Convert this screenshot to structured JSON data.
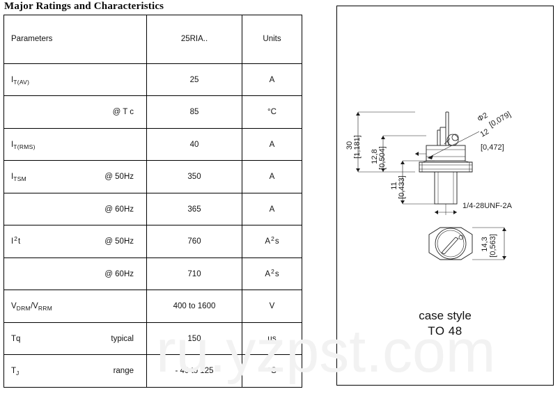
{
  "document": {
    "title": "Major Ratings and Characteristics"
  },
  "table": {
    "headers": {
      "parameters": "Parameters",
      "type": "25RIA..",
      "units": "Units"
    },
    "rows": [
      {
        "id": "it-av",
        "label_main": "I",
        "label_sub": "T(AV)",
        "condition": "",
        "value": "25",
        "units": "A"
      },
      {
        "id": "it-av-tc",
        "label_main": "",
        "label_sub": "",
        "condition": "@ T c",
        "value": "85",
        "units": "°C"
      },
      {
        "id": "it-rms",
        "label_main": "I",
        "label_sub": "T(RMS)",
        "condition": "",
        "value": "40",
        "units": "A"
      },
      {
        "id": "itsm-50",
        "label_main": "I",
        "label_sub": "TSM",
        "condition": "@ 50Hz",
        "value": "350",
        "units": "A"
      },
      {
        "id": "itsm-60",
        "label_main": "",
        "label_sub": "",
        "condition": "@ 60Hz",
        "value": "365",
        "units": "A"
      },
      {
        "id": "i2t-50",
        "label_main": "I",
        "label_sup": "2",
        "label_tail": "t",
        "condition": "@ 50Hz",
        "value": "760",
        "units_main": "A",
        "units_sup": "2",
        "units_tail": "s"
      },
      {
        "id": "i2t-60",
        "label_main": "",
        "condition": "@ 60Hz",
        "value": "710",
        "units_main": "A",
        "units_sup": "2",
        "units_tail": "s"
      },
      {
        "id": "vdrm-vrrm",
        "label_main": "V",
        "label_sub": "DRM",
        "label_mid": "/V",
        "label_sub2": "RRM",
        "condition": "",
        "value": "400 to 1600",
        "units": "V"
      },
      {
        "id": "tq",
        "label_main": "Tq",
        "condition": "typical",
        "value": "150",
        "units": "µs"
      },
      {
        "id": "tj",
        "label_main": "T",
        "label_sub": "J",
        "condition": "range",
        "value": "- 40 to 125",
        "units": "°C"
      }
    ]
  },
  "case": {
    "caption_line1": "case style",
    "caption_line2": "TO 48",
    "dimensions": {
      "overall_height": "30",
      "overall_height_in": "[1,181]",
      "body_height": "12,8",
      "body_height_in": "[0,504]",
      "stud_length": "11",
      "stud_length_in": "[0,433]",
      "lead_dia": "Φ2",
      "lead_dia_in": "[0,079]",
      "lead_length": "12",
      "lead_length_in": "[0,472]",
      "thread": "1/4-28UNF-2A",
      "hex_width": "14,3",
      "hex_width_in": "[0,563]"
    }
  },
  "watermark": {
    "text": "ru.yzpst.com"
  }
}
